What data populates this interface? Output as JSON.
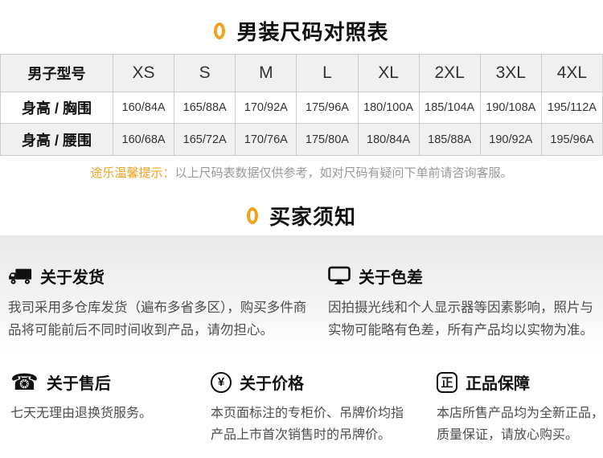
{
  "colors": {
    "accent_gold": "#f0a31c",
    "tip_orange": "#f0a11d",
    "tip_gray": "#999999",
    "table_header_bg": "#f0f0f0",
    "table_border": "#cccccc"
  },
  "size_chart": {
    "title": "男装尺码对照表",
    "table": {
      "header": [
        "男子型号",
        "XS",
        "S",
        "M",
        "L",
        "XL",
        "2XL",
        "3XL",
        "4XL"
      ],
      "rows": [
        {
          "label": "身高 / 胸围",
          "values": [
            "160/84A",
            "165/88A",
            "170/92A",
            "175/96A",
            "180/100A",
            "185/104A",
            "190/108A",
            "195/112A"
          ]
        },
        {
          "label": "身高 / 腰围",
          "values": [
            "160/68A",
            "165/72A",
            "170/76A",
            "175/80A",
            "180/84A",
            "185/88A",
            "190/92A",
            "195/96A"
          ]
        }
      ]
    },
    "tip_highlight": "途乐温馨提示：",
    "tip_text": "以上尺码表数据仅供参考，如对尺码有疑问下单前请咨询客服。"
  },
  "buyer_notes": {
    "title": "买家须知",
    "sections": [
      {
        "icon": "truck-icon",
        "heading": "关于发货",
        "body": "我司采用多仓库发货（遍布多省多区），购买多件商品将可能前后不同时间收到产品，请勿担心。"
      },
      {
        "icon": "monitor-icon",
        "heading": "关于色差",
        "body": "因拍摄光线和个人显示器等因素影响，照片与实物可能略有色差，所有产品均以实物为准。"
      },
      {
        "icon": "phone-icon",
        "heading": "关于售后",
        "body": "七天无理由退换货服务。"
      },
      {
        "icon": "yen-circle-icon",
        "heading": "关于价格",
        "body": "本页面标注的专柜价、吊牌价均指产品上市首次销售时的吊牌价。",
        "icon_glyph": "¥"
      },
      {
        "icon": "authentic-seal-icon",
        "heading": "正品保障",
        "body": "本店所售产品均为全新正品，质量保证，请放心购买。",
        "icon_glyph": "正"
      }
    ],
    "phone_glyph": "☎"
  }
}
